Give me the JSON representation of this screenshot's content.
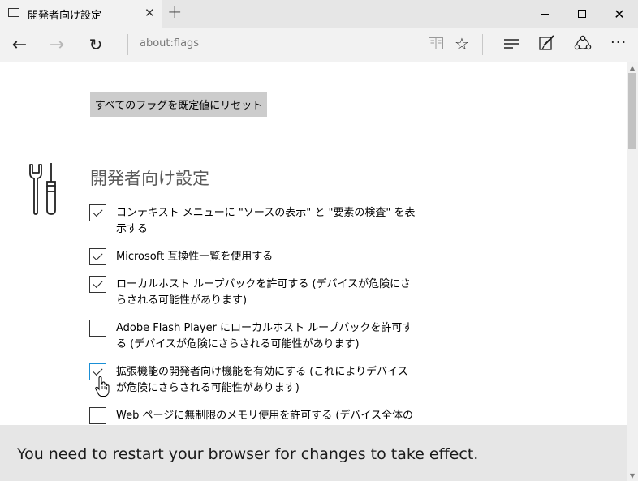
{
  "tab": {
    "title": "開発者向け設定",
    "close_glyph": "✕",
    "new_tab_glyph": "+"
  },
  "window_controls": {
    "close_glyph": "✕"
  },
  "navbar": {
    "back_glyph": "←",
    "forward_glyph": "→",
    "refresh_glyph": "↻",
    "address": "about:flags",
    "favorite_glyph": "☆",
    "more_glyph": "···"
  },
  "icons": {
    "tab": "page-icon",
    "reading_view": "book-icon",
    "favorite": "star-icon",
    "hub": "hub-icon",
    "web_note": "pen-icon",
    "share": "share-icon",
    "section": "wrench-screwdriver-icon"
  },
  "content": {
    "reset_button": "すべてのフラグを既定値にリセット",
    "section_title": "開発者向け設定",
    "options": [
      {
        "label": "コンテキスト メニューに \"ソースの表示\" と \"要素の検査\" を表示する",
        "checked": true
      },
      {
        "label": "Microsoft 互換性一覧を使用する",
        "checked": true
      },
      {
        "label": "ローカルホスト ループバックを許可する (デバイスが危険にさらされる可能性があります)",
        "checked": true
      },
      {
        "label": "Adobe Flash Player にローカルホスト ループバックを許可する (デバイスが危険にさらされる可能性があります)",
        "checked": false
      },
      {
        "label": "拡張機能の開発者向け機能を有効にする (これによりデバイスが危険にさらされる可能性があります)",
        "checked": true
      },
      {
        "label": "Web ページに無制限のメモリ使用を許可する (デバイス全体の",
        "checked": false
      }
    ]
  },
  "scrollbar": {
    "up_glyph": "▲",
    "down_glyph": "▼"
  },
  "notification": {
    "text": "You need to restart your browser for changes to take effect."
  },
  "colors": {
    "titlebar": "#e6e6e6",
    "navbar": "#f2f2f2",
    "button": "#cccccc",
    "focus": "#1a8fd6"
  }
}
